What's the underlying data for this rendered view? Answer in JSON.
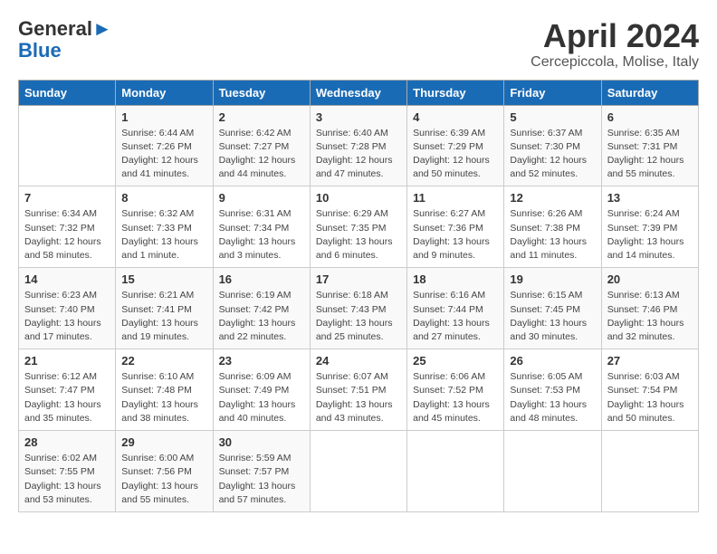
{
  "header": {
    "logo_general": "General",
    "logo_blue": "Blue",
    "month_title": "April 2024",
    "location": "Cercepiccola, Molise, Italy"
  },
  "columns": [
    "Sunday",
    "Monday",
    "Tuesday",
    "Wednesday",
    "Thursday",
    "Friday",
    "Saturday"
  ],
  "weeks": [
    [
      {
        "day": "",
        "sunrise": "",
        "sunset": "",
        "daylight": ""
      },
      {
        "day": "1",
        "sunrise": "Sunrise: 6:44 AM",
        "sunset": "Sunset: 7:26 PM",
        "daylight": "Daylight: 12 hours and 41 minutes."
      },
      {
        "day": "2",
        "sunrise": "Sunrise: 6:42 AM",
        "sunset": "Sunset: 7:27 PM",
        "daylight": "Daylight: 12 hours and 44 minutes."
      },
      {
        "day": "3",
        "sunrise": "Sunrise: 6:40 AM",
        "sunset": "Sunset: 7:28 PM",
        "daylight": "Daylight: 12 hours and 47 minutes."
      },
      {
        "day": "4",
        "sunrise": "Sunrise: 6:39 AM",
        "sunset": "Sunset: 7:29 PM",
        "daylight": "Daylight: 12 hours and 50 minutes."
      },
      {
        "day": "5",
        "sunrise": "Sunrise: 6:37 AM",
        "sunset": "Sunset: 7:30 PM",
        "daylight": "Daylight: 12 hours and 52 minutes."
      },
      {
        "day": "6",
        "sunrise": "Sunrise: 6:35 AM",
        "sunset": "Sunset: 7:31 PM",
        "daylight": "Daylight: 12 hours and 55 minutes."
      }
    ],
    [
      {
        "day": "7",
        "sunrise": "Sunrise: 6:34 AM",
        "sunset": "Sunset: 7:32 PM",
        "daylight": "Daylight: 12 hours and 58 minutes."
      },
      {
        "day": "8",
        "sunrise": "Sunrise: 6:32 AM",
        "sunset": "Sunset: 7:33 PM",
        "daylight": "Daylight: 13 hours and 1 minute."
      },
      {
        "day": "9",
        "sunrise": "Sunrise: 6:31 AM",
        "sunset": "Sunset: 7:34 PM",
        "daylight": "Daylight: 13 hours and 3 minutes."
      },
      {
        "day": "10",
        "sunrise": "Sunrise: 6:29 AM",
        "sunset": "Sunset: 7:35 PM",
        "daylight": "Daylight: 13 hours and 6 minutes."
      },
      {
        "day": "11",
        "sunrise": "Sunrise: 6:27 AM",
        "sunset": "Sunset: 7:36 PM",
        "daylight": "Daylight: 13 hours and 9 minutes."
      },
      {
        "day": "12",
        "sunrise": "Sunrise: 6:26 AM",
        "sunset": "Sunset: 7:38 PM",
        "daylight": "Daylight: 13 hours and 11 minutes."
      },
      {
        "day": "13",
        "sunrise": "Sunrise: 6:24 AM",
        "sunset": "Sunset: 7:39 PM",
        "daylight": "Daylight: 13 hours and 14 minutes."
      }
    ],
    [
      {
        "day": "14",
        "sunrise": "Sunrise: 6:23 AM",
        "sunset": "Sunset: 7:40 PM",
        "daylight": "Daylight: 13 hours and 17 minutes."
      },
      {
        "day": "15",
        "sunrise": "Sunrise: 6:21 AM",
        "sunset": "Sunset: 7:41 PM",
        "daylight": "Daylight: 13 hours and 19 minutes."
      },
      {
        "day": "16",
        "sunrise": "Sunrise: 6:19 AM",
        "sunset": "Sunset: 7:42 PM",
        "daylight": "Daylight: 13 hours and 22 minutes."
      },
      {
        "day": "17",
        "sunrise": "Sunrise: 6:18 AM",
        "sunset": "Sunset: 7:43 PM",
        "daylight": "Daylight: 13 hours and 25 minutes."
      },
      {
        "day": "18",
        "sunrise": "Sunrise: 6:16 AM",
        "sunset": "Sunset: 7:44 PM",
        "daylight": "Daylight: 13 hours and 27 minutes."
      },
      {
        "day": "19",
        "sunrise": "Sunrise: 6:15 AM",
        "sunset": "Sunset: 7:45 PM",
        "daylight": "Daylight: 13 hours and 30 minutes."
      },
      {
        "day": "20",
        "sunrise": "Sunrise: 6:13 AM",
        "sunset": "Sunset: 7:46 PM",
        "daylight": "Daylight: 13 hours and 32 minutes."
      }
    ],
    [
      {
        "day": "21",
        "sunrise": "Sunrise: 6:12 AM",
        "sunset": "Sunset: 7:47 PM",
        "daylight": "Daylight: 13 hours and 35 minutes."
      },
      {
        "day": "22",
        "sunrise": "Sunrise: 6:10 AM",
        "sunset": "Sunset: 7:48 PM",
        "daylight": "Daylight: 13 hours and 38 minutes."
      },
      {
        "day": "23",
        "sunrise": "Sunrise: 6:09 AM",
        "sunset": "Sunset: 7:49 PM",
        "daylight": "Daylight: 13 hours and 40 minutes."
      },
      {
        "day": "24",
        "sunrise": "Sunrise: 6:07 AM",
        "sunset": "Sunset: 7:51 PM",
        "daylight": "Daylight: 13 hours and 43 minutes."
      },
      {
        "day": "25",
        "sunrise": "Sunrise: 6:06 AM",
        "sunset": "Sunset: 7:52 PM",
        "daylight": "Daylight: 13 hours and 45 minutes."
      },
      {
        "day": "26",
        "sunrise": "Sunrise: 6:05 AM",
        "sunset": "Sunset: 7:53 PM",
        "daylight": "Daylight: 13 hours and 48 minutes."
      },
      {
        "day": "27",
        "sunrise": "Sunrise: 6:03 AM",
        "sunset": "Sunset: 7:54 PM",
        "daylight": "Daylight: 13 hours and 50 minutes."
      }
    ],
    [
      {
        "day": "28",
        "sunrise": "Sunrise: 6:02 AM",
        "sunset": "Sunset: 7:55 PM",
        "daylight": "Daylight: 13 hours and 53 minutes."
      },
      {
        "day": "29",
        "sunrise": "Sunrise: 6:00 AM",
        "sunset": "Sunset: 7:56 PM",
        "daylight": "Daylight: 13 hours and 55 minutes."
      },
      {
        "day": "30",
        "sunrise": "Sunrise: 5:59 AM",
        "sunset": "Sunset: 7:57 PM",
        "daylight": "Daylight: 13 hours and 57 minutes."
      },
      {
        "day": "",
        "sunrise": "",
        "sunset": "",
        "daylight": ""
      },
      {
        "day": "",
        "sunrise": "",
        "sunset": "",
        "daylight": ""
      },
      {
        "day": "",
        "sunrise": "",
        "sunset": "",
        "daylight": ""
      },
      {
        "day": "",
        "sunrise": "",
        "sunset": "",
        "daylight": ""
      }
    ]
  ]
}
